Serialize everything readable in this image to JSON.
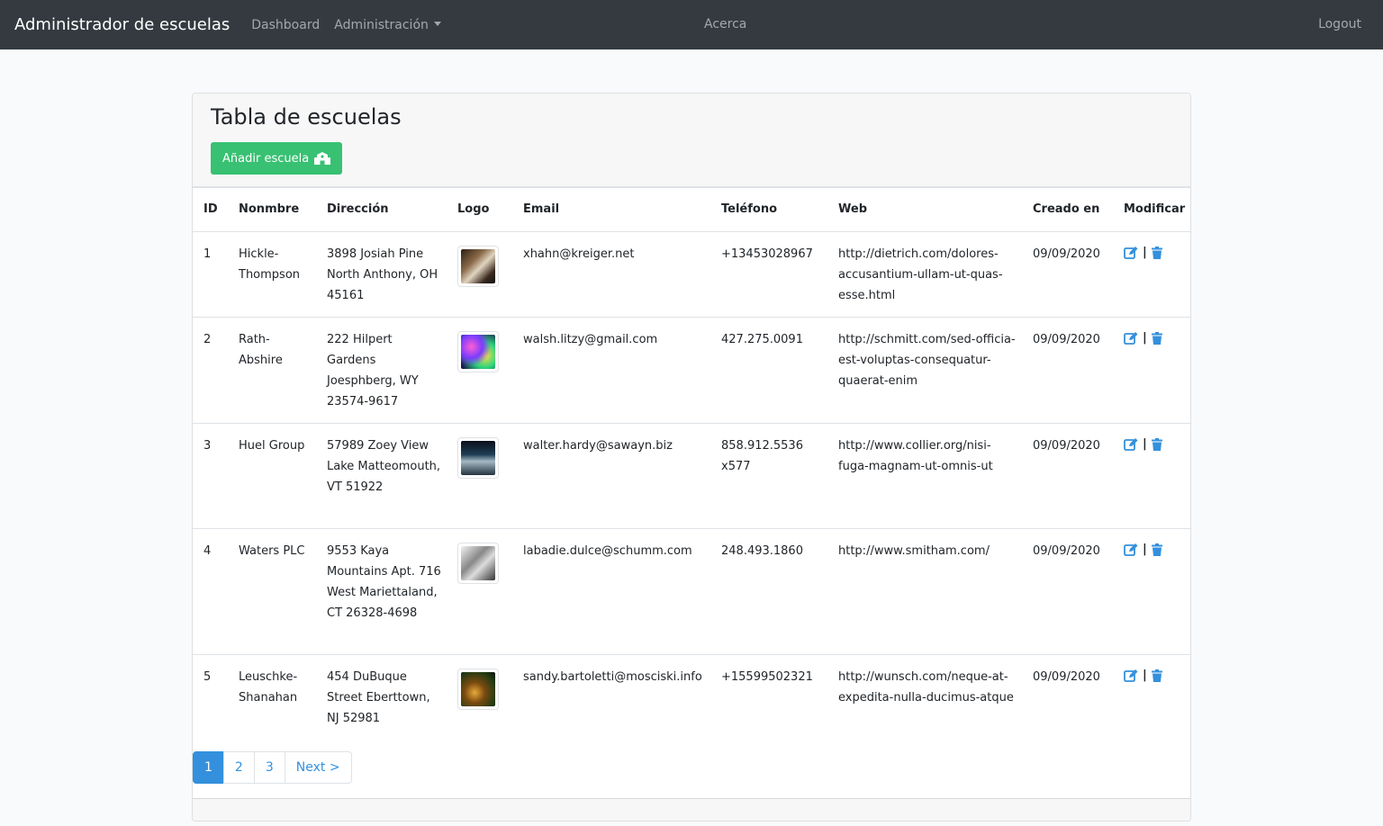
{
  "navbar": {
    "brand": "Administrador de escuelas",
    "links": [
      "Dashboard",
      "Administración"
    ],
    "center": "Acerca",
    "logout": "Logout"
  },
  "card": {
    "title": "Tabla de escuelas",
    "add_button": "Añadir escuela",
    "add_icon": "school-icon"
  },
  "table": {
    "headers": [
      "ID",
      "Nonmbre",
      "Dirección",
      "Logo",
      "Email",
      "Teléfono",
      "Web",
      "Creado en",
      "Modificar"
    ],
    "rows": [
      {
        "id": "1",
        "name": "Hickle-Thompson",
        "address": "3898 Josiah Pine North Anthony, OH 45161",
        "logo": "logo-image",
        "email": "xhahn@kreiger.net",
        "phone": "+13453028967",
        "web": "http://dietrich.com/dolores-accusantium-ullam-ut-quas-esse.html",
        "created": "09/09/2020"
      },
      {
        "id": "2",
        "name": "Rath-Abshire",
        "address": "222 Hilpert Gardens Joesphberg, WY 23574-9617",
        "logo": "logo-image",
        "email": "walsh.litzy@gmail.com",
        "phone": "427.275.0091",
        "web": "http://schmitt.com/sed-officia-est-voluptas-consequatur-quaerat-enim",
        "created": "09/09/2020"
      },
      {
        "id": "3",
        "name": "Huel Group",
        "address": "57989 Zoey View Lake Matteomouth, VT 51922",
        "logo": "logo-image",
        "email": "walter.hardy@sawayn.biz",
        "phone": "858.912.5536 x577",
        "web": "http://www.collier.org/nisi-fuga-magnam-ut-omnis-ut",
        "created": "09/09/2020"
      },
      {
        "id": "4",
        "name": "Waters PLC",
        "address": "9553 Kaya Mountains Apt. 716 West Mariettaland, CT 26328-4698",
        "logo": "logo-image",
        "email": "labadie.dulce@schumm.com",
        "phone": "248.493.1860",
        "web": "http://www.smitham.com/",
        "created": "09/09/2020"
      },
      {
        "id": "5",
        "name": "Leuschke-Shanahan",
        "address": "454 DuBuque Street Eberttown, NJ 52981",
        "logo": "logo-image",
        "email": "sandy.bartoletti@mosciski.info",
        "phone": "+15599502321",
        "web": "http://wunsch.com/neque-at-expedita-nulla-ducimus-atque",
        "created": "09/09/2020"
      }
    ],
    "action_separator": "|",
    "edit_icon": "edit-icon",
    "delete_icon": "trash-icon"
  },
  "pagination": {
    "pages": [
      "1",
      "2",
      "3"
    ],
    "next": "Next >",
    "current": "1"
  },
  "colors": {
    "navbar": "#343a40",
    "accent": "#3490dc",
    "success": "#38c172"
  }
}
